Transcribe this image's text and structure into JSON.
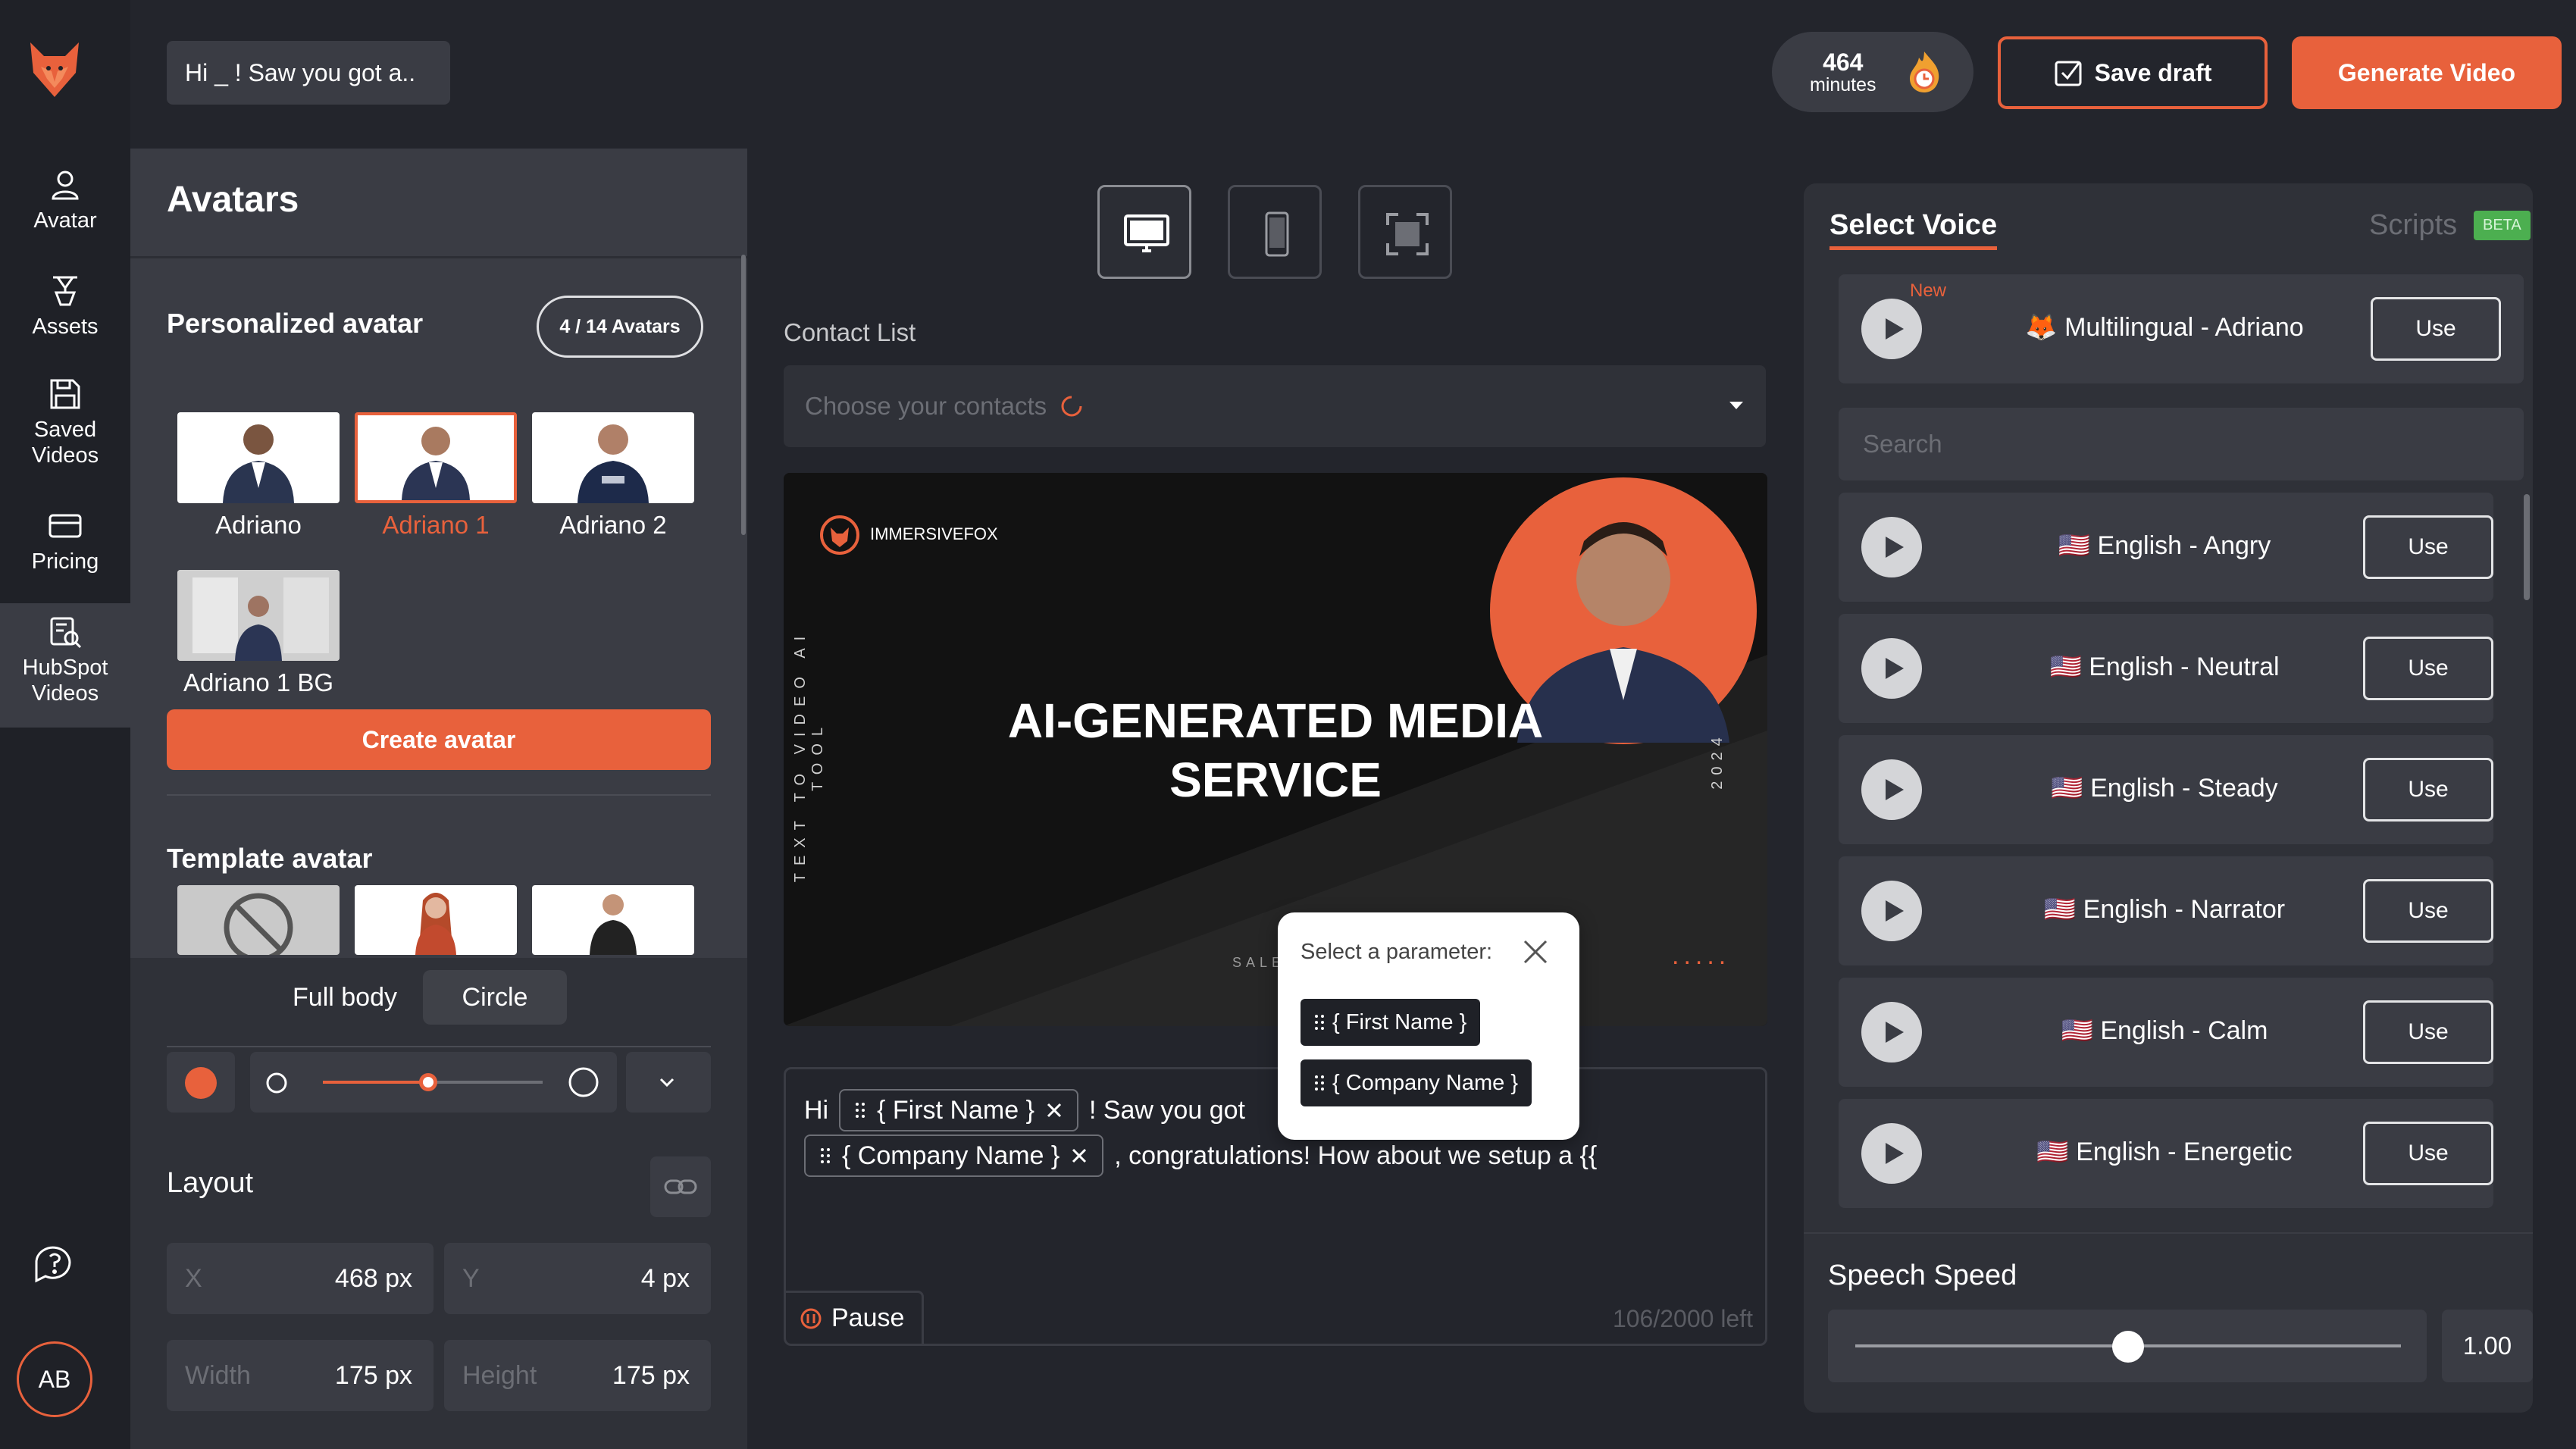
{
  "header": {
    "title_chip": "Hi _ ! Saw you got a..",
    "minutes_value": "464",
    "minutes_unit": "minutes",
    "save_label": "Save draft",
    "generate_label": "Generate Video"
  },
  "nav": {
    "items": [
      {
        "label": "Avatar",
        "icon": "user-icon"
      },
      {
        "label": "Assets",
        "icon": "assets-icon"
      },
      {
        "label": "Saved Videos",
        "icon": "save-icon"
      },
      {
        "label": "Pricing",
        "icon": "card-icon"
      },
      {
        "label": "HubSpot Videos",
        "icon": "hubspot-icon"
      }
    ],
    "user_initials": "AB"
  },
  "avatars": {
    "title": "Avatars",
    "personalized_title": "Personalized avatar",
    "count": "4 / 14 Avatars",
    "items": [
      "Adriano",
      "Adriano 1",
      "Adriano 2",
      "Adriano 1 BG"
    ],
    "selected": "Adriano 1",
    "create_label": "Create avatar",
    "template_title": "Template avatar",
    "shape_tabs": [
      "Full body",
      "Circle"
    ],
    "shape_selected": "Circle",
    "bg_color": "#e8613c",
    "size_level_fraction": 0.48,
    "layout_title": "Layout",
    "fields": [
      {
        "key": "X",
        "value": "468 px"
      },
      {
        "key": "Y",
        "value": "4 px"
      },
      {
        "key": "Width",
        "value": "175 px"
      },
      {
        "key": "Height",
        "value": "175 px"
      }
    ]
  },
  "editor": {
    "contact_label": "Contact List",
    "contact_placeholder": "Choose your contacts",
    "preview": {
      "brand": "IMMERSIVEFOX",
      "headline_1": "AI-GENERATED MEDIA",
      "headline_2": "SERVICE",
      "side_text": "TEXT TO VIDEO AI TOOL",
      "year": "2024",
      "bottom_text": "SALES",
      "dots": "....."
    },
    "script": {
      "word_hi": "Hi",
      "token_first": "{ First Name }",
      "text_mid": "! Saw you got",
      "token_company": "{ Company Name }",
      "text_end": ", congratulations! How about we setup a {{"
    },
    "pause_label": "Pause",
    "chars_left": "106/2000 left",
    "popup": {
      "title": "Select a parameter:",
      "options": [
        "{ First Name }",
        "{ Company Name }"
      ]
    }
  },
  "voice": {
    "tab_select": "Select Voice",
    "tab_scripts": "Scripts",
    "beta": "BETA",
    "featured": {
      "tag": "New",
      "name": "🦊 Multilingual - Adriano",
      "use": "Use"
    },
    "search_placeholder": "Search",
    "voices": [
      {
        "name": "🇺🇸 English - Angry",
        "use": "Use"
      },
      {
        "name": "🇺🇸 English - Neutral",
        "use": "Use"
      },
      {
        "name": "🇺🇸 English - Steady",
        "use": "Use"
      },
      {
        "name": "🇺🇸 English - Narrator",
        "use": "Use"
      },
      {
        "name": "🇺🇸 English - Calm",
        "use": "Use"
      },
      {
        "name": "🇺🇸 English - Energetic",
        "use": "Use"
      }
    ],
    "speed_title": "Speech Speed",
    "speed_value": "1.00",
    "speed_fraction": 0.5
  },
  "colors": {
    "accent": "#e8613c",
    "bg": "#23252c",
    "panel": "#3a3c44"
  }
}
